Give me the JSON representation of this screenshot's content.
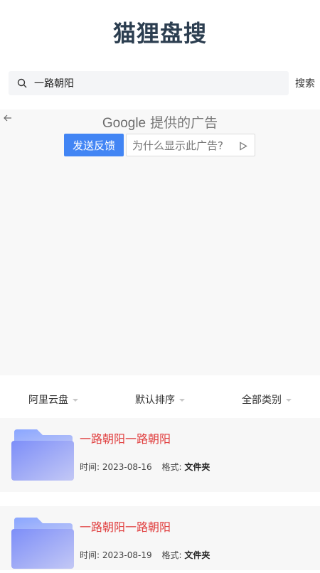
{
  "header": {
    "title": "猫狸盘搜"
  },
  "search": {
    "value": "一路朝阳",
    "button_label": "搜索"
  },
  "ad": {
    "google_label": "Google",
    "provided_label": "提供的广告",
    "feedback_label": "发送反馈",
    "why_label": "为什么显示此广告?"
  },
  "filters": [
    {
      "label": "阿里云盘"
    },
    {
      "label": "默认排序"
    },
    {
      "label": "全部类别"
    }
  ],
  "results": [
    {
      "title": "一路朝阳一路朝阳",
      "time_label": "时间:",
      "time": "2023-08-16",
      "format_label": "格式:",
      "format": "文件夹"
    },
    {
      "title": "一路朝阳一路朝阳",
      "time_label": "时间:",
      "time": "2023-08-19",
      "format_label": "格式:",
      "format": "文件夹"
    }
  ],
  "colors": {
    "title": "#2c3e50",
    "result_title": "#e03c3c",
    "ad_button": "#4285f4"
  },
  "icons": {
    "search": "search-icon",
    "back": "back-arrow-icon",
    "adchoices": "adchoices-icon",
    "folder": "folder-icon"
  }
}
